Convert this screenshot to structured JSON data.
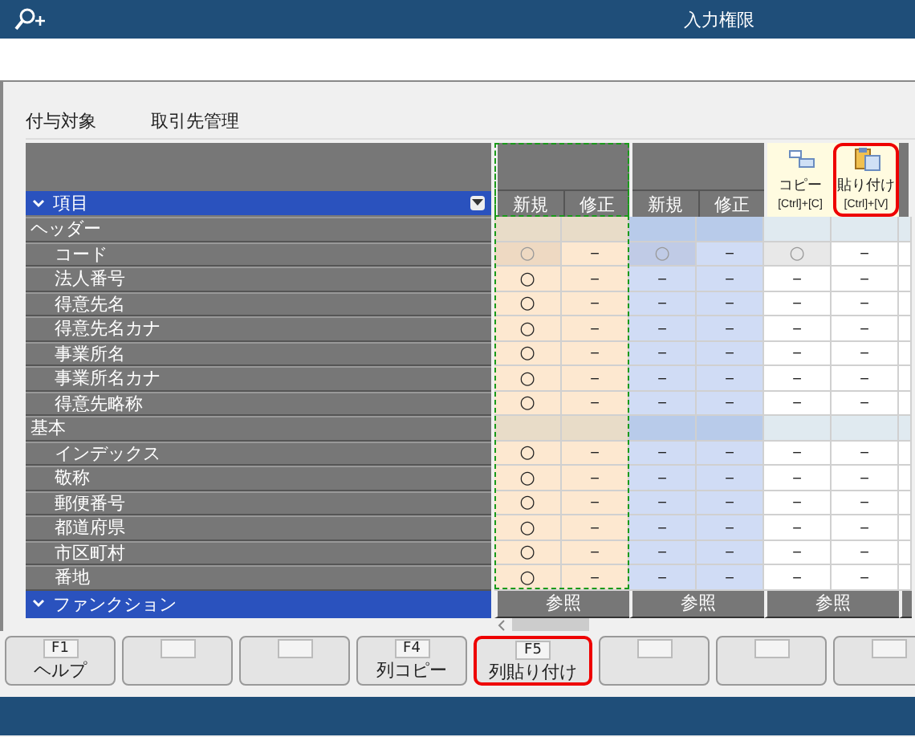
{
  "window": {
    "title": "入力権限"
  },
  "target": {
    "label": "付与対象",
    "value": "取引先管理"
  },
  "table": {
    "item_header": "項目",
    "column_groups": [
      {
        "kind": "user",
        "selected": true,
        "subheads": [
          "新規",
          "修正"
        ],
        "function": "参照"
      },
      {
        "kind": "user",
        "selected": false,
        "subheads": [
          "新規",
          "修正"
        ],
        "function": "参照"
      },
      {
        "kind": "tools",
        "tools": [
          {
            "kind": "copy",
            "label": "コピー",
            "shortcut": "[Ctrl]+[C]",
            "highlighted": false
          },
          {
            "kind": "paste",
            "label": "貼り付け",
            "shortcut": "[Ctrl]+[V]",
            "highlighted": true
          }
        ],
        "function": "参照"
      }
    ],
    "rows": [
      {
        "kind": "group",
        "label": "ヘッダー"
      },
      {
        "kind": "item",
        "label": "コード",
        "disabled": true,
        "cells": [
          "○",
          "－",
          "○",
          "－",
          "○",
          "－"
        ]
      },
      {
        "kind": "item",
        "label": "法人番号",
        "disabled": false,
        "cells": [
          "○",
          "－",
          "－",
          "－",
          "－",
          "－"
        ]
      },
      {
        "kind": "item",
        "label": "得意先名",
        "disabled": false,
        "cells": [
          "○",
          "－",
          "－",
          "－",
          "－",
          "－"
        ]
      },
      {
        "kind": "item",
        "label": "得意先名カナ",
        "disabled": false,
        "cells": [
          "○",
          "－",
          "－",
          "－",
          "－",
          "－"
        ]
      },
      {
        "kind": "item",
        "label": "事業所名",
        "disabled": false,
        "cells": [
          "○",
          "－",
          "－",
          "－",
          "－",
          "－"
        ]
      },
      {
        "kind": "item",
        "label": "事業所名カナ",
        "disabled": false,
        "cells": [
          "○",
          "－",
          "－",
          "－",
          "－",
          "－"
        ]
      },
      {
        "kind": "item",
        "label": "得意先略称",
        "disabled": false,
        "cells": [
          "○",
          "－",
          "－",
          "－",
          "－",
          "－"
        ]
      },
      {
        "kind": "group",
        "label": "基本"
      },
      {
        "kind": "item",
        "label": "インデックス",
        "disabled": false,
        "cells": [
          "○",
          "－",
          "－",
          "－",
          "－",
          "－"
        ]
      },
      {
        "kind": "item",
        "label": "敬称",
        "disabled": false,
        "cells": [
          "○",
          "－",
          "－",
          "－",
          "－",
          "－"
        ]
      },
      {
        "kind": "item",
        "label": "郵便番号",
        "disabled": false,
        "cells": [
          "○",
          "－",
          "－",
          "－",
          "－",
          "－"
        ]
      },
      {
        "kind": "item",
        "label": "都道府県",
        "disabled": false,
        "cells": [
          "○",
          "－",
          "－",
          "－",
          "－",
          "－"
        ]
      },
      {
        "kind": "item",
        "label": "市区町村",
        "disabled": false,
        "cells": [
          "○",
          "－",
          "－",
          "－",
          "－",
          "－"
        ]
      },
      {
        "kind": "item",
        "label": "番地",
        "disabled": false,
        "cells": [
          "○",
          "－",
          "－",
          "－",
          "－",
          "－"
        ]
      }
    ],
    "function_header": "ファンクション"
  },
  "function_keys": [
    {
      "kind": "key",
      "key": "F1",
      "label": "ヘルプ",
      "highlighted": false
    },
    {
      "kind": "blank",
      "highlighted": false
    },
    {
      "kind": "blank",
      "highlighted": false
    },
    {
      "kind": "key",
      "key": "F4",
      "label": "列コピー",
      "highlighted": false
    },
    {
      "kind": "key",
      "key": "F5",
      "label": "列貼り付け",
      "highlighted": true
    },
    {
      "kind": "blank",
      "highlighted": false
    },
    {
      "kind": "blank",
      "highlighted": false
    },
    {
      "kind": "blank",
      "highlighted": false
    }
  ]
}
